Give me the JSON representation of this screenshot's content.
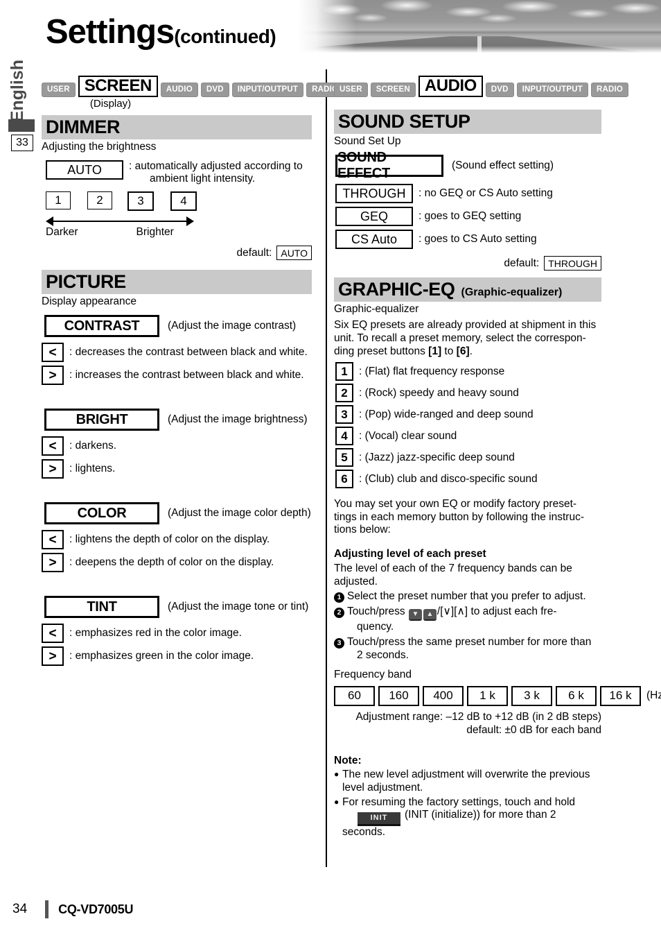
{
  "header": {
    "title": "Settings",
    "title_suffix": "(continued)",
    "language_tab": "English",
    "page_marker": "33"
  },
  "left_column": {
    "tabs": [
      {
        "label": "USER",
        "active": false
      },
      {
        "label": "SCREEN",
        "active": true
      },
      {
        "label": "AUDIO",
        "active": false
      },
      {
        "label": "DVD",
        "active": false
      },
      {
        "label": "INPUT/OUTPUT",
        "active": false
      },
      {
        "label": "RADIO",
        "active": false
      }
    ],
    "tab_sub": "(Display)",
    "dimmer": {
      "heading": "DIMMER",
      "lead": "Adjusting the brightness",
      "auto_label": "AUTO",
      "auto_desc_line1": ": automatically adjusted according to",
      "auto_desc_line2": "ambient light intensity.",
      "levels": [
        "1",
        "2",
        "3",
        "4"
      ],
      "scale_left": "Darker",
      "scale_right": "Brighter",
      "default_label": "default:",
      "default_value": "AUTO"
    },
    "picture": {
      "heading": "PICTURE",
      "lead": "Display appearance",
      "items": [
        {
          "label": "CONTRAST",
          "paren": "(Adjust the image contrast)",
          "left_icon": "chevron-left-icon",
          "left_glyph": "<",
          "left_desc": ": decreases the contrast between black and white.",
          "right_icon": "chevron-right-icon",
          "right_glyph": ">",
          "right_desc": ": increases the contrast between black and white."
        },
        {
          "label": "BRIGHT",
          "paren": "(Adjust the image brightness)",
          "left_glyph": "<",
          "left_desc": ": darkens.",
          "right_glyph": ">",
          "right_desc": ": lightens."
        },
        {
          "label": "COLOR",
          "paren": "(Adjust the image color depth)",
          "left_glyph": "<",
          "left_desc": ": lightens the depth of color on the display.",
          "right_glyph": ">",
          "right_desc": ": deepens the depth of color on the display."
        },
        {
          "label": "TINT",
          "paren": "(Adjust the image tone or tint)",
          "left_glyph": "<",
          "left_desc": ": emphasizes red in the color image.",
          "right_glyph": ">",
          "right_desc": ": emphasizes green in the color image."
        }
      ]
    }
  },
  "right_column": {
    "tabs": [
      {
        "label": "USER",
        "active": false
      },
      {
        "label": "SCREEN",
        "active": false
      },
      {
        "label": "AUDIO",
        "active": true
      },
      {
        "label": "DVD",
        "active": false
      },
      {
        "label": "INPUT/OUTPUT",
        "active": false
      },
      {
        "label": "RADIO",
        "active": false
      }
    ],
    "sound_setup": {
      "heading": "SOUND SETUP",
      "lead": "Sound Set Up",
      "effect_label": "SOUND EFFECT",
      "effect_paren": "(Sound effect setting)",
      "options": [
        {
          "label": "THROUGH",
          "desc": ": no GEQ or CS Auto setting"
        },
        {
          "label": "GEQ",
          "desc": ": goes to GEQ setting"
        },
        {
          "label": "CS Auto",
          "desc": ": goes to CS Auto setting"
        }
      ],
      "default_label": "default:",
      "default_value": "THROUGH"
    },
    "graphic_eq": {
      "heading": "GRAPHIC-EQ",
      "heading_sub": "(Graphic-equalizer)",
      "lead": "Graphic-equalizer",
      "intro_line1": "Six EQ presets are already provided at shipment in this",
      "intro_line2": "unit. To recall a preset memory, select the correspon-",
      "intro_line3_pre": "ding preset buttons ",
      "intro_line3_b1": "[1]",
      "intro_line3_mid": " to ",
      "intro_line3_b2": "[6]",
      "intro_line3_post": ".",
      "presets": [
        {
          "num": "1",
          "desc": ": (Flat) flat frequency response"
        },
        {
          "num": "2",
          "desc": ": (Rock) speedy and heavy sound"
        },
        {
          "num": "3",
          "desc": ": (Pop) wide-ranged and deep sound"
        },
        {
          "num": "4",
          "desc": ": (Vocal) clear sound"
        },
        {
          "num": "5",
          "desc": ": (Jazz) jazz-specific deep sound"
        },
        {
          "num": "6",
          "desc": ": (Club) club and disco-specific sound"
        }
      ],
      "custom_line1": "You may set your own EQ or modify factory preset-",
      "custom_line2": "tings in each memory button by following the instruc-",
      "custom_line3": "tions below:",
      "adjust_head": "Adjusting level of each preset",
      "adjust_line1": "The level of each of the 7 frequency bands can be",
      "adjust_line2": "adjusted.",
      "step1": "Select the preset number that you prefer to adjust.",
      "step2_pre": "Touch/press",
      "step2_down_glyph": "⌵",
      "step2_up_glyph": "⌴",
      "step2_mid": "/[∨][∧]",
      "step2_post": "to adjust each fre-",
      "step2_cont": "quency.",
      "step3": "Touch/press the same preset number for more than",
      "step3_cont": "2 seconds.",
      "freq_head": "Frequency band",
      "freq_bands": [
        "60",
        "160",
        "400",
        "1 k",
        "3 k",
        "6 k",
        "16 k"
      ],
      "freq_unit": "(Hz)",
      "range_line1": "Adjustment range: –12 dB to +12 dB (in 2 dB steps)",
      "range_line2": "default: ±0 dB for each band",
      "note_head": "Note:",
      "note1_line1": "The new level adjustment will overwrite the previous",
      "note1_line2": "level adjustment.",
      "note2_line1": "For resuming the factory settings, touch and hold",
      "note2_init": "INIT",
      "note2_line2": "(INIT (initialize)) for more than 2 seconds."
    }
  },
  "footer": {
    "page_number": "34",
    "model": "CQ-VD7005U"
  }
}
